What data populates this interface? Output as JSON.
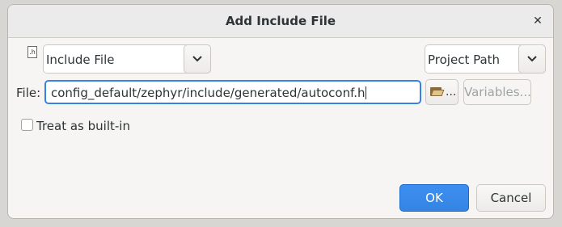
{
  "dialog": {
    "title": "Add Include File"
  },
  "kind_combo": {
    "selected": "Include File",
    "icon": "header-file-icon",
    "icon_text": ".h"
  },
  "path_combo": {
    "selected": "Project Path"
  },
  "file": {
    "label": "File:",
    "value": "config_default/zephyr/include/generated/autoconf.h",
    "browse_label": "...",
    "variables_label": "Variables..."
  },
  "options": {
    "builtin_label": "Treat as built-in",
    "builtin_checked": false
  },
  "buttons": {
    "ok": "OK",
    "cancel": "Cancel"
  },
  "colors": {
    "accent": "#3584e4"
  }
}
